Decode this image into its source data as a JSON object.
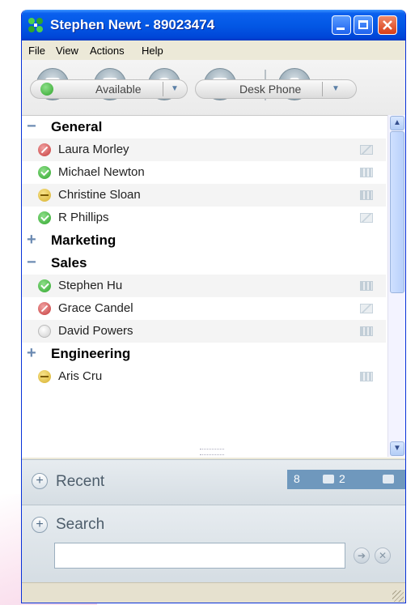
{
  "window": {
    "title": "Stephen Newt - 89023474"
  },
  "menu": [
    "File",
    "View",
    "Actions",
    "Help"
  ],
  "toolbar": {
    "buttons": [
      "phone-call-icon",
      "contact-card-icon",
      "chat-bubble-icon",
      "mail-icon",
      "dialpad-icon"
    ]
  },
  "presence": {
    "status": "Available",
    "device": "Desk Phone"
  },
  "groups": [
    {
      "name": "General",
      "expanded": true,
      "contacts": [
        {
          "name": "Laura Morley",
          "status": "busy",
          "action": "mail"
        },
        {
          "name": "Michael Newton",
          "status": "available",
          "action": "phone"
        },
        {
          "name": "Christine Sloan",
          "status": "away",
          "action": "phone"
        },
        {
          "name": "R Phillips",
          "status": "available",
          "action": "mail"
        }
      ]
    },
    {
      "name": "Marketing",
      "expanded": false,
      "contacts": []
    },
    {
      "name": "Sales",
      "expanded": true,
      "contacts": [
        {
          "name": "Stephen Hu",
          "status": "available",
          "action": "phone"
        },
        {
          "name": "Grace Candel",
          "status": "busy",
          "action": "mail"
        },
        {
          "name": "David Powers",
          "status": "offline",
          "action": "phone"
        }
      ]
    },
    {
      "name": "Engineering",
      "expanded": false,
      "contacts": [
        {
          "name": "Aris Cru",
          "status": "away",
          "action": "phone"
        }
      ]
    }
  ],
  "recent": {
    "label": "Recent",
    "calls_count": "8",
    "voicemail_count": "2"
  },
  "search": {
    "label": "Search",
    "value": ""
  },
  "colors": {
    "titlebar": "#0358e5",
    "accent": "#6f98bd"
  }
}
